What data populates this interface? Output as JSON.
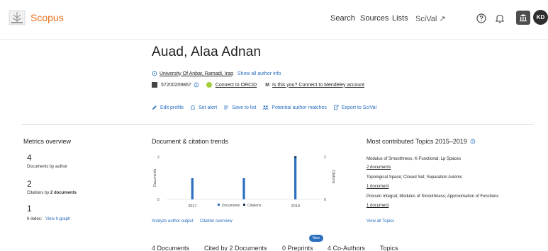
{
  "header": {
    "logo_text": "Scopus",
    "nav": {
      "search": "Search",
      "sources": "Sources",
      "lists": "Lists",
      "scival": "SciVal ↗"
    },
    "avatar_initials": "KD",
    "icons": [
      "help-icon",
      "bell-icon",
      "institution-icon"
    ]
  },
  "author": {
    "name": "Auad, Alaa Adnan",
    "affiliation": "University Of Anbar, Ramadi, Iraq",
    "show_all_info": "Show all author info",
    "scopus_id": "57200209867",
    "connect_orcid": "Connect to ORCID",
    "mendeley": "Is this you? Connect to Mendeley account"
  },
  "actions": {
    "edit_profile": "Edit profile",
    "set_alert": "Set alert",
    "save_to_list": "Save to list",
    "potential_matches": "Potential author matches",
    "export_scival": "Export to SciVal"
  },
  "metrics": {
    "title": "Metrics overview",
    "documents_value": "4",
    "documents_label": "Documents by author",
    "citations_value": "2",
    "citations_label_prefix": "Citations by ",
    "citations_label_bold": "2 documents",
    "hindex_value": "1",
    "hindex_label": "h-index:",
    "hindex_link": "View h-graph"
  },
  "trends": {
    "title": "Document & citation trends",
    "analyze_link": "Analyze author output",
    "citation_overview_link": "Citation overview"
  },
  "chart_data": {
    "type": "bar",
    "title": "Document & citation trends",
    "ylabel": "Documents",
    "y2label": "Citations",
    "x_ticks": [
      "2017",
      "2019"
    ],
    "y_ticks": [
      "0",
      "1",
      "2"
    ],
    "y2_ticks": [
      "0",
      "1",
      "2"
    ],
    "ylim": [
      0,
      2
    ],
    "series": [
      {
        "name": "Documents",
        "points": [
          {
            "x": 2017,
            "y": 1
          },
          {
            "x": 2018,
            "y": 1
          },
          {
            "x": 2019,
            "y": 2
          }
        ]
      },
      {
        "name": "Citations",
        "points": [
          {
            "x": 2019,
            "y": 2
          }
        ]
      }
    ],
    "legend": [
      "Documents",
      "Citations"
    ],
    "colors": {
      "documents": "#2b6fbf",
      "citations": "#1c2c4c"
    }
  },
  "topics": {
    "title": "Most contributed Topics 2015–2019",
    "items": [
      {
        "name": "Modulus of Smoothness; K-Functional; Lp Spaces",
        "docs": "2 documents"
      },
      {
        "name": "Topological Space; Closed Set; Separation Axioms",
        "docs": "1 document"
      },
      {
        "name": "Poisson Integral; Modulus of Smoothness; Approximation of Functions",
        "docs": "1 document"
      }
    ],
    "view_all": "View all Topics"
  },
  "tabs": {
    "documents": "4 Documents",
    "cited_by": "Cited by 2 Documents",
    "preprints": "0 Preprints",
    "coauthors": "4 Co-Authors",
    "topics": "Topics",
    "new_badge": "New"
  }
}
